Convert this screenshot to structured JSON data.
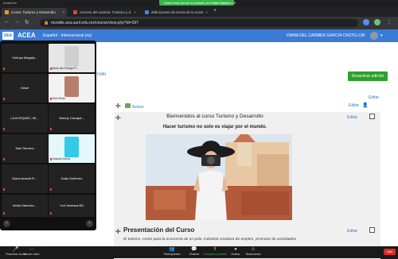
{
  "zoom_top": {
    "window_title": "Andarinin",
    "sharing_chip": "Usted está viendo la pantalla de Diana García",
    "view_options": "Ver Opciones ▾"
  },
  "browser": {
    "tabs": [
      {
        "label": "Curso: Turismo y Desarrollo",
        "favicon_color": "#f39c12",
        "active": true
      },
      {
        "label": "Actores del cambio: Turismo y d",
        "favicon_color": "#e0463a",
        "active": false
      },
      {
        "label": "definiciones de teoría de la socie",
        "favicon_color": "#4285f4",
        "active": false
      }
    ],
    "new_tab": "+",
    "url": "moodle.uea.uanl.edu.mx/course/view.php?id=297"
  },
  "moodle": {
    "brand": "ACEA",
    "logo": "UEA",
    "language": "Español - Internacional (es)",
    "user_name": "DIANA DEL CARMEN GARCIA CASTILLON",
    "edit_off_button": "Desactivar edición",
    "editar": "Editar",
    "avisos": "Avisos",
    "breadcrumb_partial": "rrollo",
    "welcome": "Bienvenidos al curso Turismo y Desarrollo",
    "tagline": "Hacer turismo no solo es viajar por el mundo.",
    "presentation_title": "Presentación del Curso",
    "presentation_text": "El turismo, motor para la economía de un país, industria creadora de empleo, promotor de actividades"
  },
  "gallery": {
    "participants": [
      {
        "name": "Cinthya Magally...",
        "has_video": false
      },
      {
        "name": "Maria del Refugio R...",
        "has_video": true,
        "face_color": "#cfcfcf"
      },
      {
        "name": "Grisel",
        "has_video": false
      },
      {
        "name": "Yireli Rolla",
        "has_video": true,
        "face_color": "#b77f6a"
      },
      {
        "name": "LILIA RIQUEZ, MI...",
        "has_video": false
      },
      {
        "name": "Wendy Carvajal...",
        "has_video": false
      },
      {
        "name": "Sairi Serrano",
        "has_video": false
      },
      {
        "name": "Yolanda Garza",
        "has_video": true,
        "face_color": "#33c9e8"
      },
      {
        "name": "Diana Araceli Fl...",
        "has_video": false
      },
      {
        "name": "Dalia Gutiérrez",
        "has_video": false
      },
      {
        "name": "Irelda Sánchez...",
        "has_video": false
      },
      {
        "name": "Yuri Vanessa BD",
        "has_video": false
      }
    ],
    "prev": "‹",
    "next": "›"
  },
  "zoom_bar": {
    "buttons": [
      {
        "label": "Reactivar Audio",
        "icon": "mic-off-icon",
        "glyph": "🎤"
      },
      {
        "label": "Iniciar video",
        "icon": "camera-off-icon",
        "glyph": "▭"
      },
      {
        "label": "Participantes",
        "icon": "participants-icon",
        "glyph": "👥"
      },
      {
        "label": "Chatear",
        "icon": "chat-icon",
        "glyph": "💬"
      },
      {
        "label": "Compartir pantalla",
        "icon": "share-screen-icon",
        "glyph": "⬆"
      },
      {
        "label": "Grabar",
        "icon": "record-icon",
        "glyph": "●"
      },
      {
        "label": "Reacciones",
        "icon": "reactions-icon",
        "glyph": "☺"
      }
    ],
    "end": "Salir"
  }
}
